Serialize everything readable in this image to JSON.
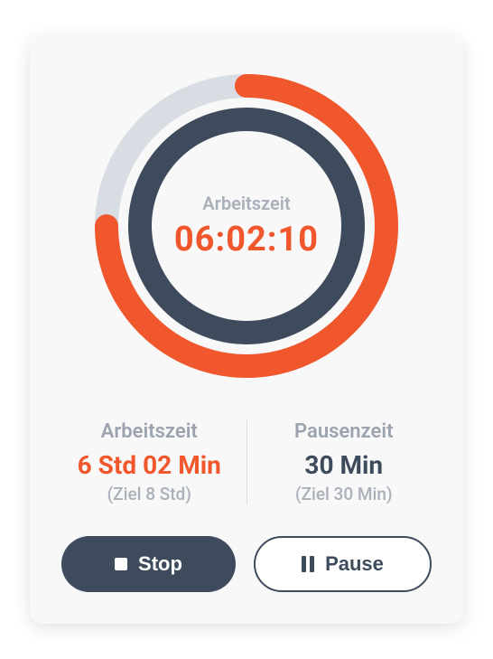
{
  "timer": {
    "label": "Arbeitszeit",
    "value": "06:02:10",
    "progress_percent": 75
  },
  "stats": {
    "work": {
      "title": "Arbeitszeit",
      "value": "6 Std 02 Min",
      "target": "(Ziel 8 Std)"
    },
    "break": {
      "title": "Pausenzeit",
      "value": "30 Min",
      "target": "(Ziel 30 Min)"
    }
  },
  "buttons": {
    "stop": "Stop",
    "pause": "Pause"
  },
  "colors": {
    "accent": "#f1572c",
    "dark": "#3e4b5c",
    "light_gray": "#d8dde3"
  }
}
